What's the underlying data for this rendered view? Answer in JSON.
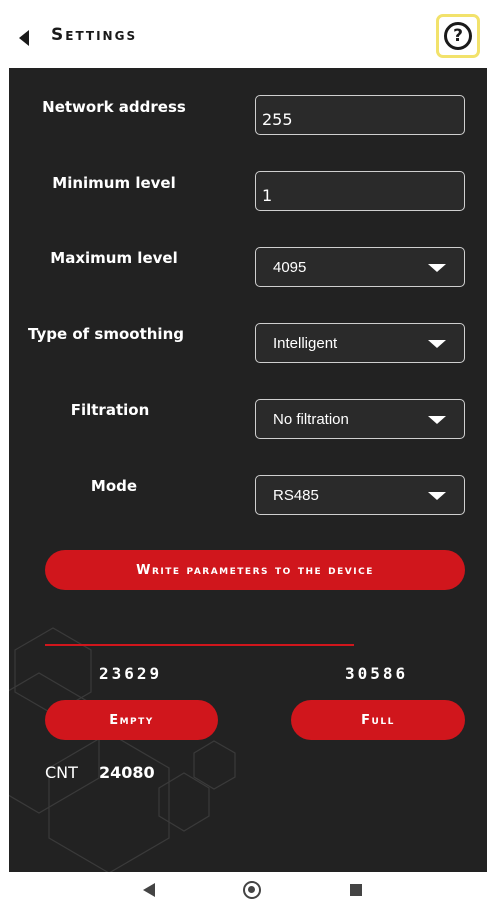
{
  "header": {
    "title": "Settings",
    "back_icon": "back-triangle-icon",
    "help_icon": "question-mark-icon",
    "help_label": "?"
  },
  "form": {
    "network_address": {
      "label": "Network address",
      "value": "255"
    },
    "minimum_level": {
      "label": "Minimum level",
      "value": "1"
    },
    "maximum_level": {
      "label": "Maximum level",
      "value": "4095"
    },
    "smoothing": {
      "label": "Type of smoothing",
      "value": "Intelligent"
    },
    "filtration": {
      "label": "Filtration",
      "value": "No filtration"
    },
    "mode": {
      "label": "Mode",
      "value": "RS485"
    }
  },
  "write_button": "Write parameters to the device",
  "calibration": {
    "empty_value": "23629",
    "full_value": "30586",
    "empty_button": "Empty",
    "full_button": "Full"
  },
  "cnt": {
    "label": "CNT",
    "value": "24080"
  },
  "colors": {
    "accent": "#d0161c",
    "background": "#222222",
    "help_highlight": "#f2e26b"
  },
  "navbar": {
    "back_icon": "nav-back-icon",
    "home_icon": "nav-home-icon",
    "recents_icon": "nav-recents-icon"
  }
}
